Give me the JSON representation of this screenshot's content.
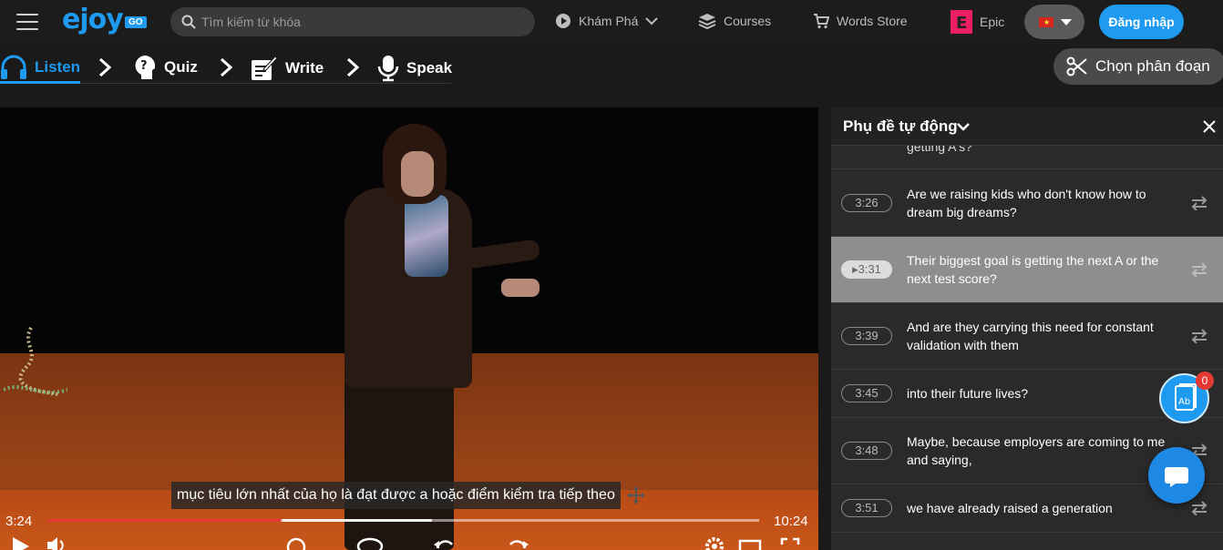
{
  "header": {
    "logo": "ejoy",
    "logo_badge": "GO",
    "search_placeholder": "Tìm kiếm từ khóa",
    "nav": {
      "explore": "Khám Phá",
      "courses": "Courses",
      "words_store": "Words Store",
      "epic": "Epic"
    },
    "language": "vietnam-flag-icon",
    "login": "Đăng nhập"
  },
  "steps": [
    {
      "label": "Listen",
      "icon": "headphones-icon",
      "active": true
    },
    {
      "label": "Quiz",
      "icon": "quiz-head-icon",
      "active": false
    },
    {
      "label": "Write",
      "icon": "write-icon",
      "active": false
    },
    {
      "label": "Speak",
      "icon": "microphone-icon",
      "active": false
    }
  ],
  "segment_button": "Chọn phân đoạn",
  "player": {
    "subtitle": "mục tiêu lớn nhất của họ là đạt được a hoặc điểm kiểm tra tiếp theo",
    "current_time": "3:24",
    "total_time": "10:24",
    "progress": 0.327,
    "buffer_start": 0.33,
    "buffer_end": 0.54
  },
  "transcript": {
    "title": "Phụ đề tự động",
    "cut_text": "getting A's?",
    "rows": [
      {
        "time": "3:26",
        "text": "Are we raising kids who don't know how to dream big dreams?"
      },
      {
        "time": "3:31",
        "text": "Their biggest goal is getting the next A or the next test score?",
        "active": true
      },
      {
        "time": "3:39",
        "text": "And are they carrying this need for constant validation with them"
      },
      {
        "time": "3:45",
        "text": "into their future lives?"
      },
      {
        "time": "3:48",
        "text": "Maybe, because employers are coming to me and saying,"
      },
      {
        "time": "3:51",
        "text": "we have already raised a generation"
      }
    ]
  },
  "fab": {
    "dictionary_badge": "0",
    "dictionary_label": "Ab"
  },
  "colors": {
    "accent": "#1e9bf0",
    "progress": "#e53935",
    "active_row": "#8e8e8e"
  }
}
